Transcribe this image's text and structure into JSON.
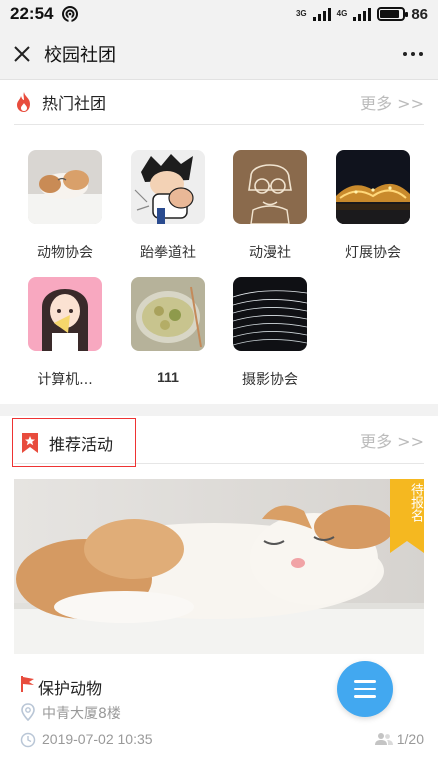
{
  "status_bar": {
    "time": "22:54",
    "net_top": "3G",
    "net_bottom": "4G",
    "battery": "86",
    "battery_level": 0.86
  },
  "header": {
    "title": "校园社团"
  },
  "hot_clubs": {
    "title": "热门社团",
    "more": "更多 >>",
    "items": [
      {
        "name": "动物协会",
        "image": "cat"
      },
      {
        "name": "跆拳道社",
        "image": "cartoon-boy"
      },
      {
        "name": "动漫社",
        "image": "sketch"
      },
      {
        "name": "灯展协会",
        "image": "night-lights"
      },
      {
        "name": "计算机...",
        "image": "anime-girl"
      },
      {
        "name": "111",
        "image": "food-bowl"
      },
      {
        "name": "摄影协会",
        "image": "light-streaks"
      }
    ]
  },
  "recommended": {
    "title": "推荐活动",
    "more": "更多 >>",
    "activity": {
      "badge": "待报名",
      "title": "保护动物",
      "location": "中青大厦8楼",
      "time": "2019-07-02 10:35",
      "participants": "1/20"
    }
  },
  "colors": {
    "accent_red": "#e84c3d",
    "badge_yellow": "#f5b820",
    "fab_blue": "#42a8f0"
  }
}
